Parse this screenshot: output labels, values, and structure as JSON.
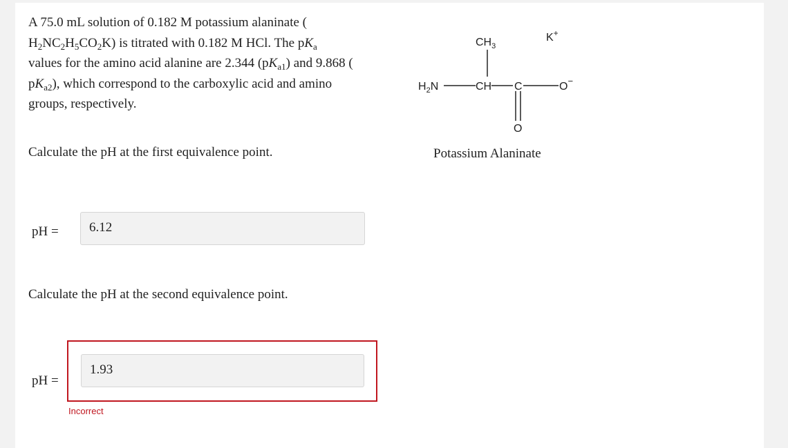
{
  "problem": {
    "t1": "A 75.0 mL solution of 0.182 M potassium alaninate (",
    "f_h": "H",
    "f_h_sub": "2",
    "f_nc": "NC",
    "f_nc_sub": "2",
    "f_h2": "H",
    "f_h2_sub": "5",
    "f_co": "CO",
    "f_co_sub": "2",
    "f_k": "K) is titrated with 0.182 M HCl. The p",
    "pk_var": "K",
    "pk_sub": "a",
    "t2": "values for the amino acid alanine are 2.344 (p",
    "pk1_var": "K",
    "pk1_sub": "a1",
    "t3": ") and 9.868 (",
    "t4_p": "p",
    "pk2_var": "K",
    "pk2_sub": "a2",
    "t4": "), which correspond to the carboxylic acid and amino",
    "t5": "groups, respectively."
  },
  "q1": {
    "text": "Calculate the pH at the first equivalence point.",
    "label": "pH =",
    "value": "6.12"
  },
  "q2": {
    "text": "Calculate the pH at the second equivalence point.",
    "label": "pH =",
    "value": "1.93",
    "feedback": "Incorrect"
  },
  "structure": {
    "caption": "Potassium Alaninate",
    "ch3": "CH",
    "ch3_sub": "3",
    "h2n_h": "H",
    "h2n_sub": "2",
    "h2n_n": "N",
    "ch": "CH",
    "c": "C",
    "o_single": "O",
    "o_charge": "−",
    "o_double": "O",
    "k": "K",
    "k_charge": "+"
  },
  "colors": {
    "incorrect": "#c0161f",
    "field_bg": "#f2f2f2"
  }
}
